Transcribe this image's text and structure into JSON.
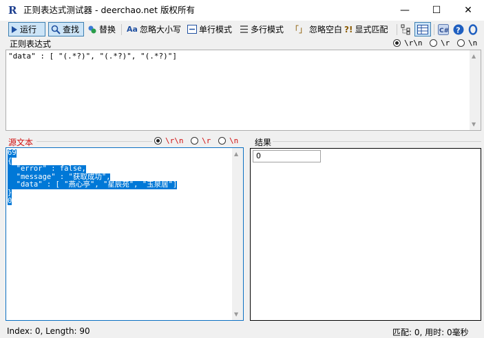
{
  "window": {
    "app_icon": "R",
    "title": "正则表达式测试器 - deerchao.net 版权所有",
    "minimize": "—",
    "maximize": "☐",
    "close": "✕"
  },
  "toolbar": {
    "run": "运行",
    "find": "查找",
    "replace": "替换",
    "ignore_case": "忽略大小写",
    "single_line": "单行模式",
    "multi_line": "多行模式",
    "ignore_whitespace_icon": "「」",
    "ignore_whitespace": "忽略空白",
    "explicit_capture_icon": "?!",
    "explicit_capture": "显式匹配"
  },
  "regex": {
    "label": "正则表达式",
    "text": "\"data\" : [ \"(.*?)\", \"(.*?)\", \"(.*?)\"]",
    "newline_options": [
      "\\r\\n",
      "\\r",
      "\\n"
    ]
  },
  "source": {
    "label": "源文本",
    "newline_options": [
      "\\r\\n",
      "\\r",
      "\\n"
    ],
    "lines": [
      "69",
      "{",
      "  \"error\" : false,",
      "  \"message\" : \"获取成功\",",
      "  \"data\" : [ \"燕心亭\", \"星辰苑\", \"玉泉居\"]",
      "}",
      "0"
    ]
  },
  "result": {
    "label": "结果",
    "value": "0"
  },
  "status": {
    "left": "Index: 0, Length: 90",
    "right": "匹配:   0, 用时: 0毫秒"
  },
  "colors": {
    "selection": "#0078d7",
    "source_label": "#d01010",
    "focus_border": "#0a6fc2"
  }
}
